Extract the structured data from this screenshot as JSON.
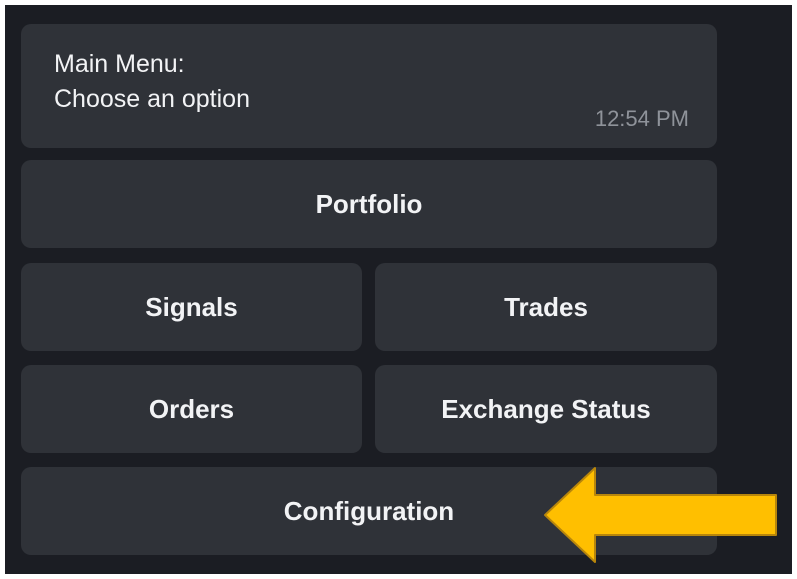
{
  "message": {
    "title": "Main Menu:",
    "body": "Choose an option",
    "time": "12:54 PM"
  },
  "keyboard": {
    "rows": [
      [
        "Portfolio"
      ],
      [
        "Signals",
        "Trades"
      ],
      [
        "Orders",
        "Exchange Status"
      ],
      [
        "Configuration"
      ]
    ]
  },
  "colors": {
    "background": "#1b1d23",
    "button": "#2f3238",
    "text": "#f2f3f5",
    "timestamp": "#8f939a",
    "annotation_arrow": "#ffbf00"
  },
  "annotation": {
    "icon": "left-arrow-icon"
  }
}
